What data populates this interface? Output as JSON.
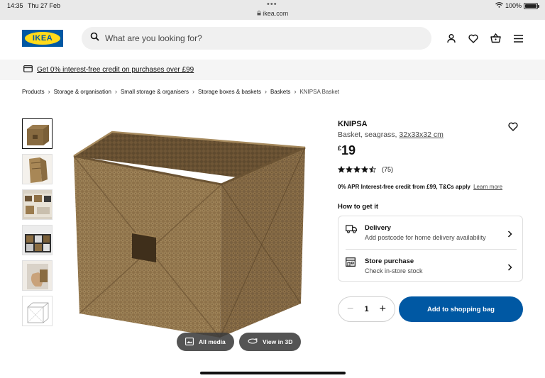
{
  "status_bar": {
    "time": "14:35",
    "date": "Thu 27 Feb",
    "url": "ikea.com",
    "battery": "100%"
  },
  "header": {
    "logo_text": "IKEA",
    "search_placeholder": "What are you looking for?",
    "icons": [
      "user-icon",
      "heart-icon",
      "basket-icon",
      "menu-icon"
    ]
  },
  "promo": {
    "text": "Get 0% interest-free credit on purchases over £99",
    "icon": "credit-card-icon"
  },
  "breadcrumb": [
    "Products",
    "Storage & organisation",
    "Small storage & organisers",
    "Storage boxes & baskets",
    "Baskets",
    "KNIPSA Basket"
  ],
  "gallery": {
    "thumbnail_count": 6,
    "media_buttons": {
      "all_media": "All media",
      "view_3d": "View in 3D"
    }
  },
  "product": {
    "name": "KNIPSA",
    "description": "Basket, seagrass,",
    "dimensions": "32x33x32 cm",
    "currency": "£",
    "price": "19",
    "rating_value": 4.5,
    "review_count": "(75)",
    "credit_text": "0% APR Interest-free credit from £99, T&Cs apply",
    "credit_link": "Learn more"
  },
  "how_to_get": {
    "title": "How to get it",
    "options": [
      {
        "title": "Delivery",
        "subtitle": "Add postcode for home delivery availability",
        "icon": "truck-icon"
      },
      {
        "title": "Store purchase",
        "subtitle": "Check in-store stock",
        "icon": "store-icon"
      }
    ]
  },
  "purchase": {
    "quantity": "1",
    "add_label": "Add to shopping bag"
  },
  "colors": {
    "brand_blue": "#0058a3",
    "brand_yellow": "#ffda1a",
    "seagrass": "#8b6f45"
  }
}
